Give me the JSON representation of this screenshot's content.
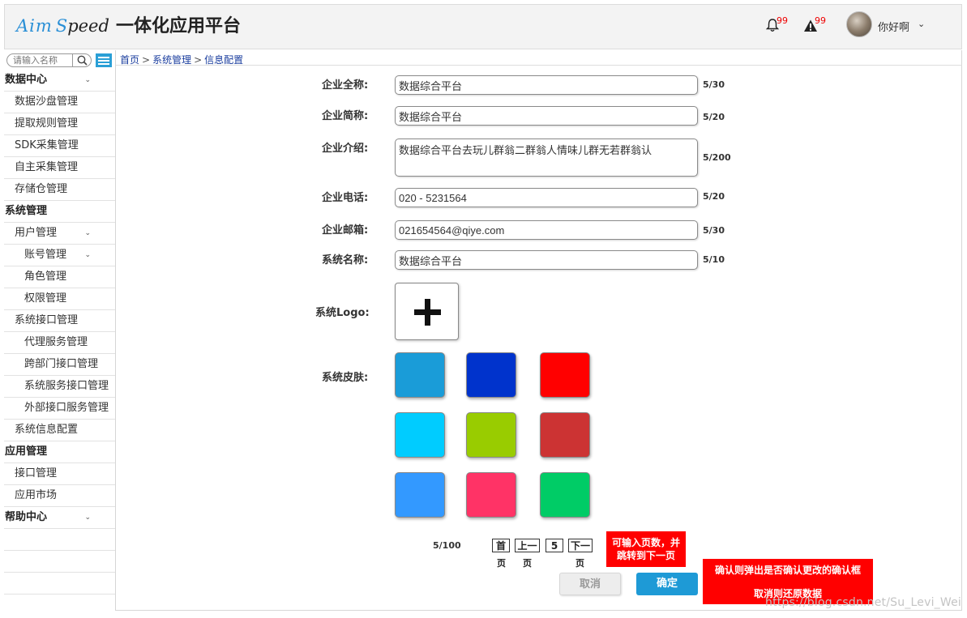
{
  "header": {
    "brand_part1": "Aim",
    "brand_part2": "S",
    "brand_part3": "peed",
    "app_title": "一体化应用平台",
    "notification_count": "99",
    "alert_count": "99",
    "username": "你好啊",
    "icons": [
      "bell-icon",
      "alert-triangle-icon",
      "avatar",
      "chevron-down-icon"
    ]
  },
  "sidebar": {
    "search_placeholder": "请输入名称",
    "items": [
      {
        "label": "数据中心",
        "level": 0,
        "chevron": "⌄"
      },
      {
        "label": "数据沙盘管理",
        "level": 1
      },
      {
        "label": "提取规则管理",
        "level": 1
      },
      {
        "label": "SDK采集管理",
        "level": 1
      },
      {
        "label": "自主采集管理",
        "level": 1
      },
      {
        "label": "存储仓管理",
        "level": 1
      },
      {
        "label": "系统管理",
        "level": 0
      },
      {
        "label": "用户管理",
        "level": 1,
        "chevron": "⌄"
      },
      {
        "label": "账号管理",
        "level": 2,
        "chevron": "⌄"
      },
      {
        "label": "角色管理",
        "level": 2
      },
      {
        "label": "权限管理",
        "level": 2
      },
      {
        "label": "系统接口管理",
        "level": 1
      },
      {
        "label": "代理服务管理",
        "level": 2
      },
      {
        "label": "跨部门接口管理",
        "level": 2
      },
      {
        "label": "系统服务接口管理",
        "level": 2
      },
      {
        "label": "外部接口服务管理",
        "level": 2
      },
      {
        "label": "系统信息配置",
        "level": 1
      },
      {
        "label": "应用管理",
        "level": 0
      },
      {
        "label": "接口管理",
        "level": 1
      },
      {
        "label": "应用市场",
        "level": 1
      },
      {
        "label": "帮助中心",
        "level": 0,
        "chevron": "⌄"
      },
      {
        "label": "",
        "level": 1
      },
      {
        "label": "",
        "level": 1
      },
      {
        "label": "",
        "level": 1
      }
    ]
  },
  "breadcrumb": {
    "home": "首页",
    "sep": ">",
    "section": "系统管理",
    "page": "信息配置"
  },
  "form": {
    "company_full_name": {
      "label": "企业全称:",
      "value": "数据综合平台",
      "count": "5/30"
    },
    "company_short_name": {
      "label": "企业简称:",
      "value": "数据综合平台",
      "count": "5/20"
    },
    "company_intro": {
      "label": "企业介绍:",
      "value": "数据综合平台去玩儿群翁二群翁人情味儿群无若群翁认",
      "count": "5/200"
    },
    "company_phone": {
      "label": "企业电话:",
      "value": "020 - 5231564",
      "count": "5/20"
    },
    "company_email": {
      "label": "企业邮箱:",
      "value": "021654564@qiye.com",
      "count": "5/30"
    },
    "system_name": {
      "label": "系统名称:",
      "value": "数据综合平台",
      "count": "5/10"
    },
    "system_logo": {
      "label": "系统Logo:"
    },
    "system_skin": {
      "label": "系统皮肤:",
      "colors": [
        "#1a9cd8",
        "#0033cc",
        "#ff0000",
        "#00ccff",
        "#99cc00",
        "#cc3333",
        "#3399ff",
        "#ff3366",
        "#00cc66"
      ]
    }
  },
  "pagination": {
    "count": "5/100",
    "first_top": "首",
    "first_bottom": "页",
    "prev_top": "上一",
    "prev_bottom": "页",
    "page": "5",
    "next_top": "下一",
    "next_bottom": "页"
  },
  "notes": {
    "pagination_note_line1": "可输入页数，并",
    "pagination_note_line2": "跳转到下一页",
    "confirm_note_line1": "确认则弹出是否确认更改的确认框",
    "confirm_note_line2": "取消则还原数据"
  },
  "buttons": {
    "cancel": "取消",
    "confirm": "确定"
  },
  "watermark": "https://blog.csdn.net/Su_Levi_Wei"
}
